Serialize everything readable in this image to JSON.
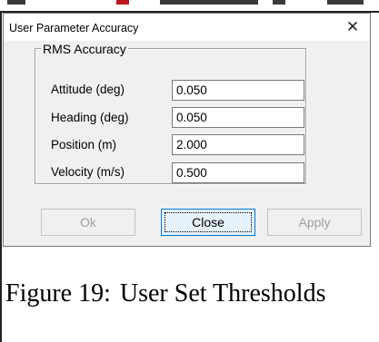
{
  "dialog": {
    "title": "User Parameter Accuracy",
    "close_icon": "close-icon",
    "group": {
      "legend": "RMS Accuracy",
      "fields": [
        {
          "label": "Attitude (deg)",
          "value": "0.050"
        },
        {
          "label": "Heading (deg)",
          "value": "0.050"
        },
        {
          "label": "Position (m)",
          "value": "2.000"
        },
        {
          "label": "Velocity (m/s)",
          "value": "0.500"
        }
      ]
    },
    "buttons": {
      "ok": "Ok",
      "close": "Close",
      "apply": "Apply"
    }
  },
  "caption": {
    "number": "Figure 19:",
    "text": "User Set Thresholds"
  },
  "colors": {
    "dialog_bg": "#f0f0f0",
    "focus_border": "#0078d7",
    "disabled_text": "#a0a0a0"
  }
}
